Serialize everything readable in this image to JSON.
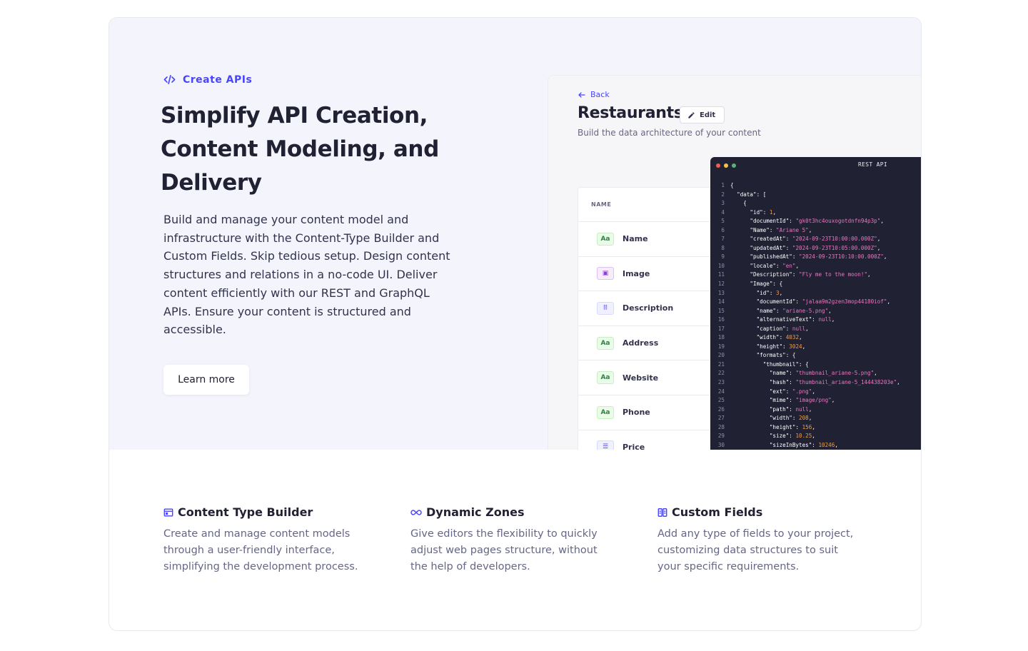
{
  "hero": {
    "eyebrow": "Create APIs",
    "headline": "Simplify API Creation, Content Modeling, and Delivery",
    "body": "Build and manage your content model and infrastructure with the Content-Type Builder and Custom Fields. Skip tedious setup. Design content structures and relations in a no-code UI. Deliver content efficiently with our REST and GraphQL APIs. Ensure your content is structured and accessible.",
    "cta_label": "Learn more"
  },
  "mock": {
    "back_label": "Back",
    "title": "Restaurants",
    "edit_label": "Edit",
    "subtitle": "Build the data architecture of your content",
    "table_header": "NAME",
    "fields": [
      {
        "label": "Name",
        "icon": "text-field-icon",
        "glyph": "Aa"
      },
      {
        "label": "Image",
        "icon": "media-field-icon",
        "glyph": "▣"
      },
      {
        "label": "Description",
        "icon": "blocks-field-icon",
        "glyph": "⠿"
      },
      {
        "label": "Address",
        "icon": "text-field-icon",
        "glyph": "Aa"
      },
      {
        "label": "Website",
        "icon": "text-field-icon",
        "glyph": "Aa"
      },
      {
        "label": "Phone",
        "icon": "text-field-icon",
        "glyph": "Aa"
      },
      {
        "label": "Price",
        "icon": "list-field-icon",
        "glyph": "☰"
      }
    ],
    "code_title": "REST API",
    "code_lines": [
      "{",
      "  \"data\": [",
      "    {",
      "      \"id\": 1,",
      "      \"documentId\": \"gk0t3hc4ouxogotdnfn94p3p\",",
      "      \"Name\": \"Ariane 5\",",
      "      \"createdAt\": \"2024-09-23T10:00:00.000Z\",",
      "      \"updatedAt\": \"2024-09-23T10:05:00.000Z\",",
      "      \"publishedAt\": \"2024-09-23T10:10:00.000Z\",",
      "      \"locale\": \"en\",",
      "      \"Description\": \"Fly me to the moon!\",",
      "      \"Image\": {",
      "        \"id\": 3,",
      "        \"documentId\": \"jalaa9m2gzen3mop44180iof\",",
      "        \"name\": \"ariane-5.png\",",
      "        \"alternativeText\": null,",
      "        \"caption\": null,",
      "        \"width\": 4032,",
      "        \"height\": 3024,",
      "        \"formats\": {",
      "          \"thumbnail\": {",
      "            \"name\": \"thumbnail_ariane-5.png\",",
      "            \"hash\": \"thumbnail_ariane-5_144438203e\",",
      "            \"ext\": \".png\",",
      "            \"mime\": \"image/png\",",
      "            \"path\": null,",
      "            \"width\": 208,",
      "            \"height\": 156,",
      "            \"size\": 10.25,",
      "            \"sizeInBytes\": 10246,"
    ]
  },
  "features": [
    {
      "title": "Content Type Builder",
      "icon": "layout-icon",
      "desc": "Create and manage content models through a user-friendly interface, simplifying the development process."
    },
    {
      "title": "Dynamic Zones",
      "icon": "infinity-icon",
      "desc": "Give editors the flexibility to quickly adjust web pages structure, without the help of developers."
    },
    {
      "title": "Custom Fields",
      "icon": "fields-icon",
      "desc": "Add any type of fields to your project, customizing data structures to suit your specific requirements."
    }
  ],
  "colors": {
    "accent": "#4945ff",
    "heading": "#212134",
    "hero_bg": "#f4f5fc",
    "code_bg": "#212134",
    "dot_red": "#ee5e52",
    "dot_yellow": "#f5c24c",
    "dot_green": "#5cb176"
  }
}
